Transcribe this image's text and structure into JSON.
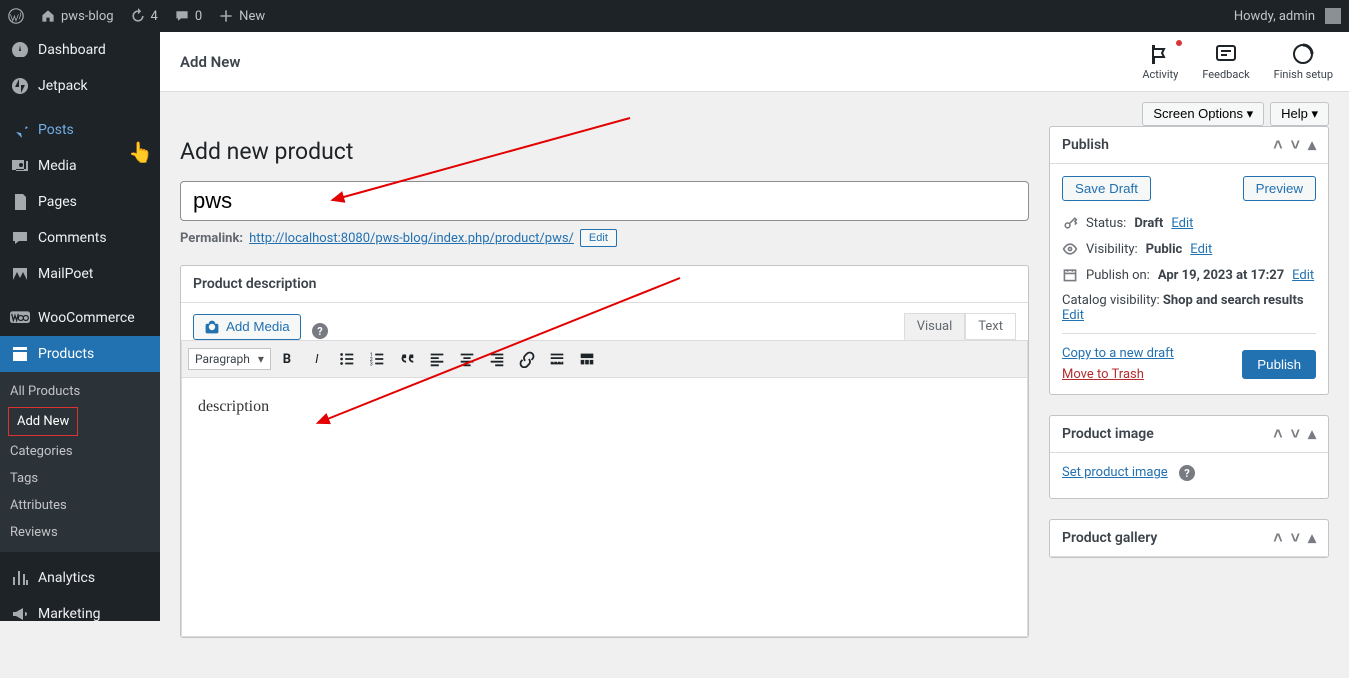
{
  "admin_bar": {
    "site": "pws-blog",
    "updates": "4",
    "comments": "0",
    "new": "New",
    "howdy": "Howdy, admin"
  },
  "sidebar": {
    "dashboard": "Dashboard",
    "jetpack": "Jetpack",
    "posts": "Posts",
    "media": "Media",
    "pages": "Pages",
    "comments": "Comments",
    "mailpoet": "MailPoet",
    "woocommerce": "WooCommerce",
    "products": "Products",
    "submenu": {
      "all_products": "All Products",
      "add_new": "Add New",
      "categories": "Categories",
      "tags": "Tags",
      "attributes": "Attributes",
      "reviews": "Reviews"
    },
    "analytics": "Analytics",
    "marketing": "Marketing"
  },
  "header": {
    "title": "Add New",
    "activity": "Activity",
    "feedback": "Feedback",
    "finish": "Finish setup"
  },
  "tabs": {
    "screen_options": "Screen Options  ▾",
    "help": "Help  ▾"
  },
  "page": {
    "heading": "Add new product",
    "title_value": "pws",
    "permalink_label": "Permalink:",
    "permalink_url": "http://localhost:8080/pws-blog/index.php/product/pws/",
    "edit": "Edit"
  },
  "editor": {
    "box_title": "Product description",
    "add_media": "Add Media",
    "visual": "Visual",
    "text": "Text",
    "format": "Paragraph",
    "content": "description"
  },
  "publish": {
    "title": "Publish",
    "save_draft": "Save Draft",
    "preview": "Preview",
    "status_label": "Status:",
    "status_value": "Draft",
    "visibility_label": "Visibility:",
    "visibility_value": "Public",
    "publish_on_label": "Publish on:",
    "publish_on_value": "Apr 19, 2023 at 17:27",
    "catalog_label": "Catalog visibility:",
    "catalog_value": "Shop and search results",
    "edit": "Edit",
    "copy": "Copy to a new draft",
    "trash": "Move to Trash",
    "publish_btn": "Publish"
  },
  "product_image": {
    "title": "Product image",
    "link": "Set product image"
  },
  "product_gallery": {
    "title": "Product gallery"
  }
}
